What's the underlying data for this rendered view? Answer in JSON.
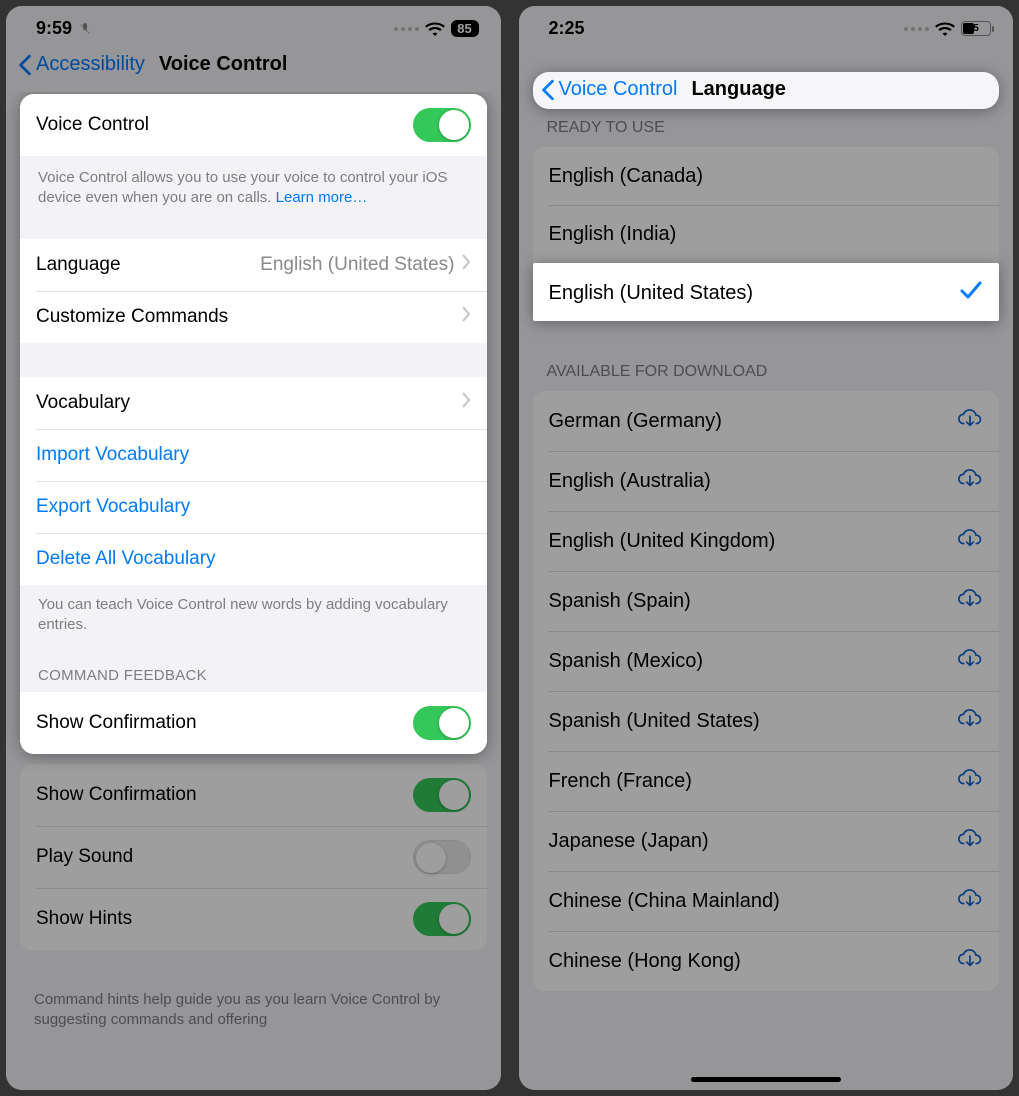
{
  "left": {
    "status": {
      "time": "9:59",
      "battery": "85"
    },
    "nav": {
      "back": "Accessibility",
      "title": "Voice Control"
    },
    "voice_control": {
      "label": "Voice Control",
      "desc_pre": "Voice Control allows you to use your voice to control your iOS device even when you are on calls. ",
      "learn_more": "Learn more…"
    },
    "language": {
      "label": "Language",
      "value": "English (United States)"
    },
    "customize": {
      "label": "Customize Commands"
    },
    "vocabulary": {
      "label": "Vocabulary"
    },
    "import_vocab": "Import Vocabulary",
    "export_vocab": "Export Vocabulary",
    "delete_vocab": "Delete All Vocabulary",
    "vocab_footer": "You can teach Voice Control new words by adding vocabulary entries.",
    "feedback_header": "COMMAND FEEDBACK",
    "show_conf": "Show Confirmation",
    "play_sound": "Play Sound",
    "show_hints": "Show Hints",
    "hints_footer": "Command hints help guide you as you learn Voice Control by suggesting commands and offering"
  },
  "right": {
    "status": {
      "time": "2:25",
      "battery": "5"
    },
    "nav": {
      "back": "Voice Control",
      "title": "Language"
    },
    "ready_header": "READY TO USE",
    "ready": [
      "English (Canada)",
      "English (India)",
      "English (United States)"
    ],
    "selected_index": 2,
    "download_header": "AVAILABLE FOR DOWNLOAD",
    "download": [
      "German (Germany)",
      "English (Australia)",
      "English (United Kingdom)",
      "Spanish (Spain)",
      "Spanish (Mexico)",
      "Spanish (United States)",
      "French (France)",
      "Japanese (Japan)",
      "Chinese (China Mainland)",
      "Chinese (Hong Kong)"
    ]
  }
}
